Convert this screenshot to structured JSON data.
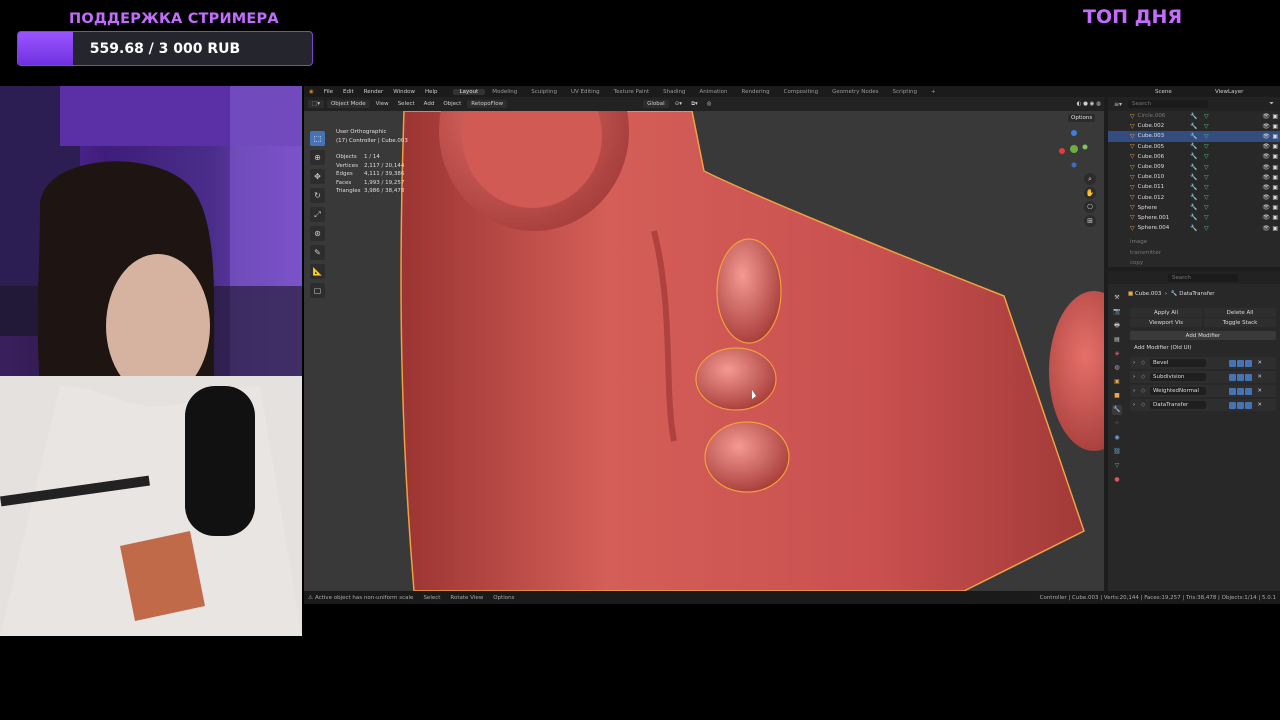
{
  "overlay": {
    "donate_title": "ПОДДЕРЖКА СТРИМЕРА",
    "donate_amount": "559.68 / 3 000 RUB",
    "donate_progress": 0.1866,
    "top_day": "ТОП ДНЯ",
    "accent": "#c36dff"
  },
  "blender": {
    "menu": [
      "File",
      "Edit",
      "Render",
      "Window",
      "Help"
    ],
    "workspaces": [
      "Layout",
      "Modeling",
      "Sculpting",
      "UV Editing",
      "Texture Paint",
      "Shading",
      "Animation",
      "Rendering",
      "Compositing",
      "Geometry Nodes",
      "Scripting"
    ],
    "active_workspace": "Layout",
    "add_tab": "+",
    "header": {
      "mode": "Object Mode",
      "view": "View",
      "select": "Select",
      "add": "Add",
      "object": "Object",
      "addon": "RetopoFlow",
      "orientation": "Global",
      "options": "Options"
    },
    "scene": "Scene",
    "view_layer": "ViewLayer",
    "viewport": {
      "view_name": "User Orthographic",
      "context": "(17) Controller | Cube.003",
      "stats": [
        {
          "label": "Objects",
          "value": "1 / 14"
        },
        {
          "label": "Vertices",
          "value": "2,117 / 20,144"
        },
        {
          "label": "Edges",
          "value": "4,111 / 39,386"
        },
        {
          "label": "Faces",
          "value": "1,993 / 19,257"
        },
        {
          "label": "Triangles",
          "value": "3,986 / 38,478"
        }
      ],
      "surface_color": "#c9504f"
    },
    "outliner": {
      "search_placeholder": "Search",
      "items": [
        {
          "name": "Circle.006",
          "dim": true
        },
        {
          "name": "Cube.002"
        },
        {
          "name": "Cube.003",
          "selected": true
        },
        {
          "name": "Cube.005"
        },
        {
          "name": "Cube.006"
        },
        {
          "name": "Cube.009"
        },
        {
          "name": "Cube.010"
        },
        {
          "name": "Cube.011"
        },
        {
          "name": "Cube.012"
        },
        {
          "name": "Sphere"
        },
        {
          "name": "Sphere.001"
        },
        {
          "name": "Sphere.004"
        }
      ],
      "collections": [
        "image",
        "transmitter",
        "copy"
      ]
    },
    "properties": {
      "search_placeholder": "Search",
      "object": "Cube.003",
      "modifier_breadcrumb": "DataTransfer",
      "apply_all": "Apply All",
      "delete_all": "Delete All",
      "viewport_vis": "Viewport Vis",
      "toggle_stack": "Toggle Stack",
      "add_modifier": "Add Modifier",
      "add_modifier_old": "Add Modifier (Old UI)",
      "modifiers": [
        "Bevel",
        "Subdivision",
        "WeightedNormal",
        "DataTransfer"
      ]
    },
    "status": {
      "warning": "Active object has non-uniform scale",
      "select": "Select",
      "rotate": "Rotate View",
      "options": "Options",
      "right": "Controller | Cube.003 | Verts:20,144 | Faces:19,257 | Tris:38,478 | Objects:1/14 | 5.0.1"
    }
  }
}
